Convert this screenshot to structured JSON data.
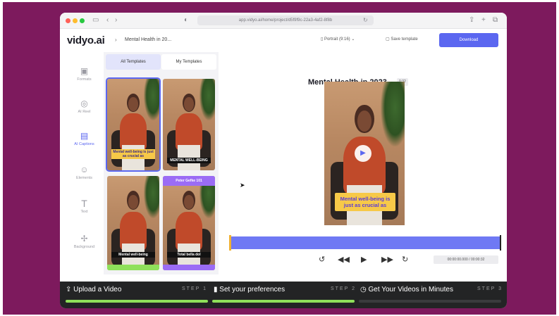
{
  "colors": {
    "background": "#7d1a5d",
    "accent": "#5b67f0",
    "caption_yellow": "#f7c948",
    "progress_green": "#8fe05a"
  },
  "browser": {
    "url": "app.vidyo.ai/home/project/d5f9f9c-22a3-4af2-8f8b",
    "icons": [
      "sidebar-icon",
      "back-icon",
      "forward-icon",
      "shield-icon",
      "reload-icon",
      "share-icon",
      "new-tab-icon",
      "tabs-icon"
    ]
  },
  "header": {
    "logo": "vidyo.ai",
    "breadcrumb": "Mental Health in 20...",
    "format_select": "Portrait (9:16)",
    "save_template": "Save template",
    "download": "Download"
  },
  "rail": {
    "items": [
      {
        "label": "Formats",
        "icon": "image-icon"
      },
      {
        "label": "AI Reel",
        "icon": "bulb-icon"
      },
      {
        "label": "AI Captions",
        "icon": "captions-icon"
      },
      {
        "label": "Elements",
        "icon": "shapes-icon"
      },
      {
        "label": "Text",
        "icon": "text-icon"
      },
      {
        "label": "Background",
        "icon": "background-icon"
      }
    ]
  },
  "templates": {
    "tabs": [
      "All Templates",
      "My Templates"
    ],
    "items": [
      {
        "caption": "Mental well-being is just as crucial as"
      },
      {
        "caption": "MENTAL WELL-BEING"
      },
      {
        "caption": "Mental well-being"
      },
      {
        "caption": "Total bella dol"
      }
    ],
    "banner_text": "Peter Gefke 101"
  },
  "editor": {
    "title": "Mental Health in 2023",
    "badge": "0:32",
    "caption": "Mental well-being is just as crucial as",
    "play_icon": "play-icon",
    "timecode": "00:00:00.000 / 00:00:32",
    "controls": [
      "rewind-5-icon",
      "skip-back-icon",
      "play-icon",
      "skip-forward-icon",
      "forward-5-icon"
    ]
  },
  "steps": [
    {
      "label": "Upload a Video",
      "step": "STEP 1",
      "icon": "upload-icon",
      "progress": 1.0
    },
    {
      "label": "Set your preferences",
      "step": "STEP 2",
      "icon": "settings-icon",
      "progress": 1.0
    },
    {
      "label": "Get Your Videos in Minutes",
      "step": "STEP 3",
      "icon": "clock-icon",
      "progress": 0.0
    }
  ]
}
